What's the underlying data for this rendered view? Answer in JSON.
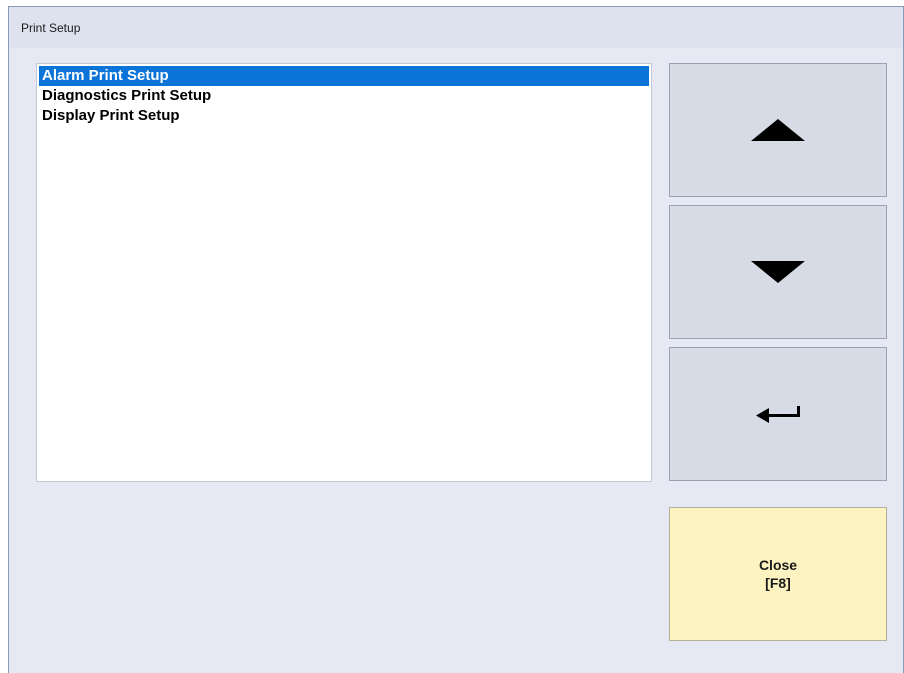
{
  "window": {
    "title": "Print Setup"
  },
  "list": {
    "items": [
      {
        "label": "Alarm Print Setup",
        "selected": true
      },
      {
        "label": "Diagnostics Print Setup",
        "selected": false
      },
      {
        "label": "Display Print Setup",
        "selected": false
      }
    ]
  },
  "buttons": {
    "up_icon": "triangle-up-icon",
    "down_icon": "triangle-down-icon",
    "enter_icon": "enter-arrow-icon",
    "close_label": "Close",
    "close_shortcut": "[F8]"
  },
  "colors": {
    "selection": "#0a74d9",
    "close_button": "#fdf3c0",
    "side_button": "#d6dbe6",
    "window_background": "#e6e9f3"
  }
}
